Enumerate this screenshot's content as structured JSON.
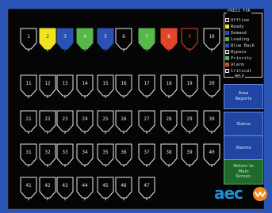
{
  "legend": {
    "title": "PRESS FOR",
    "help": "HELP",
    "items": [
      {
        "label": "Offline",
        "color": "#1a1a1a",
        "border": "#ffffff"
      },
      {
        "label": "Ready",
        "color": "#f2e31e",
        "border": "#f2e31e"
      },
      {
        "label": "Demand",
        "color": "#2a52b6",
        "border": "#2a52b6"
      },
      {
        "label": "Loading",
        "color": "#58b84b",
        "border": "#58b84b"
      },
      {
        "label": "Blow Back",
        "color": "#2a52b6",
        "border": "#2a52b6"
      },
      {
        "label": "Bypass",
        "color": "#1a1a1a",
        "border": "#ffffff"
      },
      {
        "label": "Priority",
        "color": "#58b84b",
        "border": "#58b84b"
      },
      {
        "label": "Alarm",
        "color": "#e1452a",
        "border": "#e1452a"
      },
      {
        "label": "Critical",
        "color": "#1a1a1a",
        "border": "#ffffff"
      }
    ]
  },
  "side_buttons": [
    {
      "id": "area-reports",
      "lines": [
        "Area",
        "Reports"
      ],
      "style": "blue"
    },
    {
      "id": "status",
      "lines": [
        "Status"
      ],
      "style": "blue"
    },
    {
      "id": "alarms",
      "lines": [
        "Alarms"
      ],
      "style": "blue"
    },
    {
      "id": "return-main",
      "lines": [
        "Return to",
        "Main",
        "Screen"
      ],
      "style": "green"
    }
  ],
  "logo": {
    "text": "aec"
  },
  "stations": [
    {
      "n": "1",
      "fill": "none",
      "stroke": "#e8e8e8",
      "text": "#e8e8e8"
    },
    {
      "n": "2",
      "fill": "#f2e31e",
      "stroke": "#f2e31e",
      "text": "#1a1a1a"
    },
    {
      "n": "3",
      "fill": "#2a52b6",
      "stroke": "#2a52b6",
      "text": "#d8e0f6"
    },
    {
      "n": "4",
      "fill": "#58b84b",
      "stroke": "#58b84b",
      "text": "#e8f5e6"
    },
    {
      "n": "5",
      "fill": "#2a52b6",
      "stroke": "#2a52b6",
      "text": "#d8e0f6"
    },
    {
      "n": "6",
      "fill": "none",
      "stroke": "#e8e8e8",
      "text": "#e8e8e8"
    },
    {
      "n": "7",
      "fill": "#58b84b",
      "stroke": "#58b84b",
      "text": "#e8f5e6"
    },
    {
      "n": "8",
      "fill": "#e1452a",
      "stroke": "#e1452a",
      "text": "#fde6df"
    },
    {
      "n": "9",
      "fill": "none",
      "stroke": "#e1452a",
      "text": "#e1452a"
    },
    {
      "n": "10",
      "fill": "none",
      "stroke": "#e8e8e8",
      "text": "#e8e8e8"
    },
    {
      "n": "11",
      "fill": "none",
      "stroke": "#e8e8e8",
      "text": "#e8e8e8"
    },
    {
      "n": "12",
      "fill": "none",
      "stroke": "#e8e8e8",
      "text": "#e8e8e8"
    },
    {
      "n": "13",
      "fill": "none",
      "stroke": "#e8e8e8",
      "text": "#e8e8e8"
    },
    {
      "n": "14",
      "fill": "none",
      "stroke": "#e8e8e8",
      "text": "#e8e8e8"
    },
    {
      "n": "15",
      "fill": "none",
      "stroke": "#e8e8e8",
      "text": "#e8e8e8"
    },
    {
      "n": "16",
      "fill": "none",
      "stroke": "#e8e8e8",
      "text": "#e8e8e8"
    },
    {
      "n": "17",
      "fill": "none",
      "stroke": "#e8e8e8",
      "text": "#e8e8e8"
    },
    {
      "n": "18",
      "fill": "none",
      "stroke": "#e8e8e8",
      "text": "#e8e8e8"
    },
    {
      "n": "19",
      "fill": "none",
      "stroke": "#e8e8e8",
      "text": "#e8e8e8"
    },
    {
      "n": "20",
      "fill": "none",
      "stroke": "#e8e8e8",
      "text": "#e8e8e8"
    },
    {
      "n": "21",
      "fill": "none",
      "stroke": "#e8e8e8",
      "text": "#e8e8e8"
    },
    {
      "n": "22",
      "fill": "none",
      "stroke": "#e8e8e8",
      "text": "#e8e8e8"
    },
    {
      "n": "23",
      "fill": "none",
      "stroke": "#e8e8e8",
      "text": "#e8e8e8"
    },
    {
      "n": "24",
      "fill": "none",
      "stroke": "#e8e8e8",
      "text": "#e8e8e8"
    },
    {
      "n": "25",
      "fill": "none",
      "stroke": "#e8e8e8",
      "text": "#e8e8e8"
    },
    {
      "n": "26",
      "fill": "none",
      "stroke": "#e8e8e8",
      "text": "#e8e8e8"
    },
    {
      "n": "27",
      "fill": "none",
      "stroke": "#e8e8e8",
      "text": "#e8e8e8"
    },
    {
      "n": "28",
      "fill": "none",
      "stroke": "#e8e8e8",
      "text": "#e8e8e8"
    },
    {
      "n": "29",
      "fill": "none",
      "stroke": "#e8e8e8",
      "text": "#e8e8e8"
    },
    {
      "n": "30",
      "fill": "none",
      "stroke": "#e8e8e8",
      "text": "#e8e8e8"
    },
    {
      "n": "31",
      "fill": "none",
      "stroke": "#e8e8e8",
      "text": "#e8e8e8"
    },
    {
      "n": "32",
      "fill": "none",
      "stroke": "#e8e8e8",
      "text": "#e8e8e8"
    },
    {
      "n": "33",
      "fill": "none",
      "stroke": "#e8e8e8",
      "text": "#e8e8e8"
    },
    {
      "n": "34",
      "fill": "none",
      "stroke": "#e8e8e8",
      "text": "#e8e8e8"
    },
    {
      "n": "35",
      "fill": "none",
      "stroke": "#e8e8e8",
      "text": "#e8e8e8"
    },
    {
      "n": "36",
      "fill": "none",
      "stroke": "#e8e8e8",
      "text": "#e8e8e8"
    },
    {
      "n": "37",
      "fill": "none",
      "stroke": "#e8e8e8",
      "text": "#e8e8e8"
    },
    {
      "n": "38",
      "fill": "none",
      "stroke": "#e8e8e8",
      "text": "#e8e8e8"
    },
    {
      "n": "39",
      "fill": "none",
      "stroke": "#e8e8e8",
      "text": "#e8e8e8"
    },
    {
      "n": "40",
      "fill": "none",
      "stroke": "#e8e8e8",
      "text": "#e8e8e8"
    },
    {
      "n": "41",
      "fill": "none",
      "stroke": "#e8e8e8",
      "text": "#e8e8e8"
    },
    {
      "n": "42",
      "fill": "none",
      "stroke": "#e8e8e8",
      "text": "#e8e8e8"
    },
    {
      "n": "43",
      "fill": "none",
      "stroke": "#e8e8e8",
      "text": "#e8e8e8"
    },
    {
      "n": "44",
      "fill": "none",
      "stroke": "#e8e8e8",
      "text": "#e8e8e8"
    },
    {
      "n": "45",
      "fill": "none",
      "stroke": "#e8e8e8",
      "text": "#e8e8e8"
    },
    {
      "n": "46",
      "fill": "none",
      "stroke": "#e8e8e8",
      "text": "#e8e8e8"
    },
    {
      "n": "47",
      "fill": "none",
      "stroke": "#e8e8e8",
      "text": "#e8e8e8"
    }
  ]
}
